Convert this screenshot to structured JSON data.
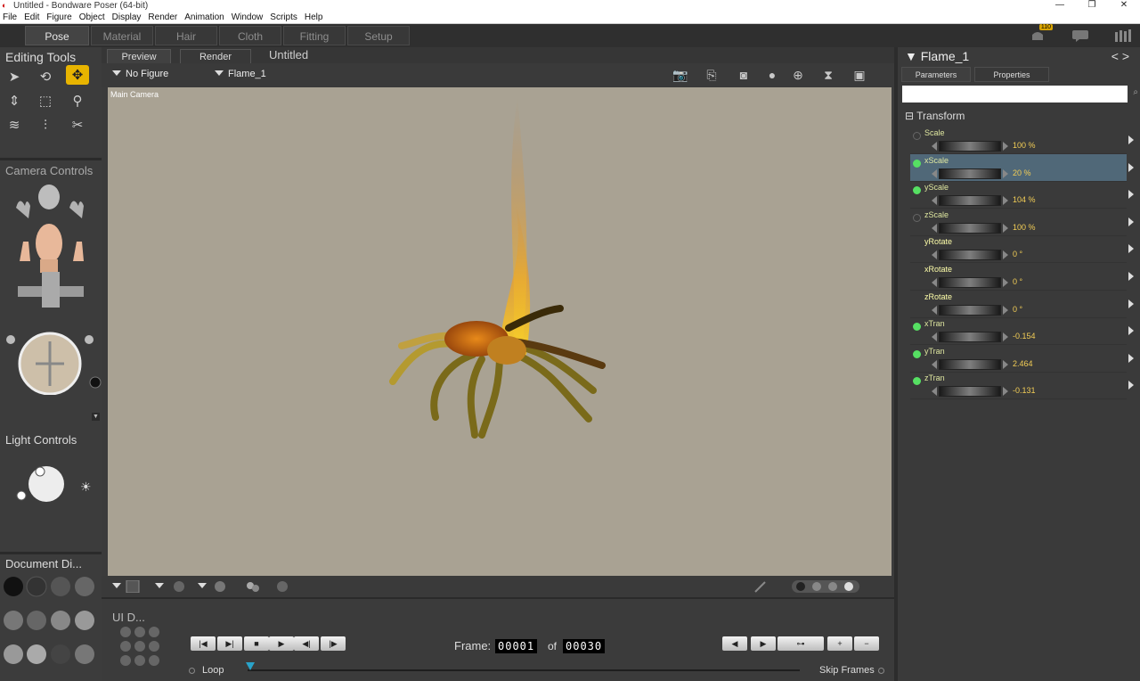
{
  "window": {
    "title": "Untitled - Bondware Poser (64-bit)"
  },
  "menu": [
    "File",
    "Edit",
    "Figure",
    "Object",
    "Display",
    "Render",
    "Animation",
    "Window",
    "Scripts",
    "Help"
  ],
  "rooms": [
    "Pose",
    "Material",
    "Hair",
    "Cloth",
    "Fitting",
    "Setup"
  ],
  "notification_count": "110",
  "left": {
    "editing_tools": "Editing Tools",
    "camera_controls": "Camera Controls",
    "light_controls": "Light Controls",
    "document_display": "Document Di..."
  },
  "document": {
    "preview_tab": "Preview",
    "render_tab": "Render",
    "title": "Untitled"
  },
  "viewport": {
    "figure_select": "No Figure",
    "actor_select": "Flame_1",
    "camera_label": "Main Camera",
    "background_color": "#a9a293"
  },
  "ui_dots": "UI D...",
  "animation": {
    "frame_label": "Frame:",
    "current_frame": "00001",
    "of_label": "of",
    "total_frames": "00030",
    "loop_label": "Loop",
    "skip_frames_label": "Skip Frames"
  },
  "right": {
    "actor": "Flame_1",
    "tabs": [
      "Parameters",
      "Properties"
    ],
    "group": "Transform",
    "params": [
      {
        "name": "Scale",
        "value": "100 %",
        "dot": false
      },
      {
        "name": "xScale",
        "value": "20 %",
        "dot": true
      },
      {
        "name": "yScale",
        "value": "104 %",
        "dot": true
      },
      {
        "name": "zScale",
        "value": "100 %",
        "dot": false
      },
      {
        "name": "yRotate",
        "value": "0 °",
        "dot": null
      },
      {
        "name": "xRotate",
        "value": "0 °",
        "dot": null
      },
      {
        "name": "zRotate",
        "value": "0 °",
        "dot": null
      },
      {
        "name": "xTran",
        "value": "-0.154",
        "dot": true
      },
      {
        "name": "yTran",
        "value": "2.464",
        "dot": true
      },
      {
        "name": "zTran",
        "value": "-0.131",
        "dot": true
      }
    ]
  }
}
